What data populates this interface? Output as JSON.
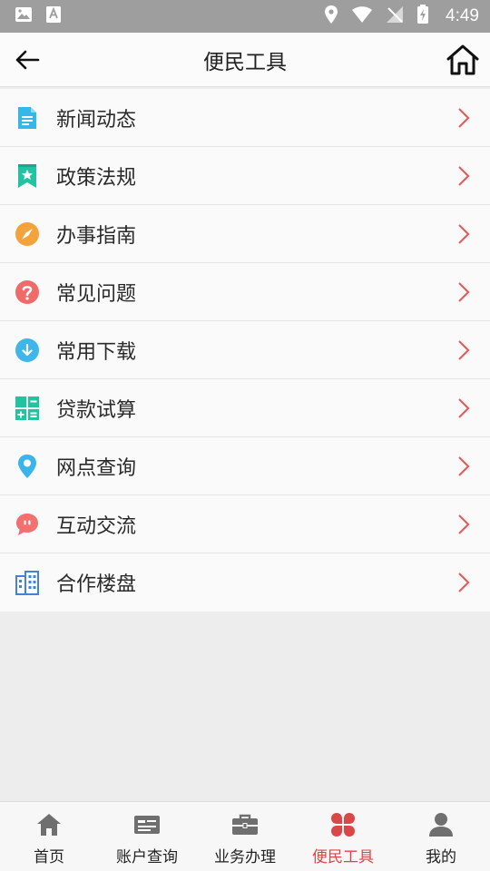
{
  "status_bar": {
    "time": "4:49"
  },
  "header": {
    "title": "便民工具"
  },
  "menu": {
    "items": [
      {
        "label": "新闻动态",
        "icon": "news-document-icon",
        "color": "#35b7e8"
      },
      {
        "label": "政策法规",
        "icon": "bookmark-star-icon",
        "color": "#24c2a2"
      },
      {
        "label": "办事指南",
        "icon": "compass-icon",
        "color": "#f4a23c"
      },
      {
        "label": "常见问题",
        "icon": "question-icon",
        "color": "#f06a6a"
      },
      {
        "label": "常用下载",
        "icon": "download-icon",
        "color": "#3fb6ea"
      },
      {
        "label": "贷款试算",
        "icon": "calculator-icon",
        "color": "#22c4a0"
      },
      {
        "label": "网点查询",
        "icon": "location-pin-icon",
        "color": "#3ab5ea"
      },
      {
        "label": "互动交流",
        "icon": "chat-bubble-icon",
        "color": "#f27070"
      },
      {
        "label": "合作楼盘",
        "icon": "building-icon",
        "color": "#4a7fd6"
      }
    ],
    "chevron_color": "#e06060"
  },
  "tabs": [
    {
      "label": "首页",
      "icon": "home-icon"
    },
    {
      "label": "账户查询",
      "icon": "id-card-icon"
    },
    {
      "label": "业务办理",
      "icon": "briefcase-icon"
    },
    {
      "label": "便民工具",
      "icon": "grid-tools-icon",
      "active": true
    },
    {
      "label": "我的",
      "icon": "person-icon"
    }
  ],
  "colors": {
    "accent": "#d94848",
    "tab_icon": "#6f6f6f"
  }
}
